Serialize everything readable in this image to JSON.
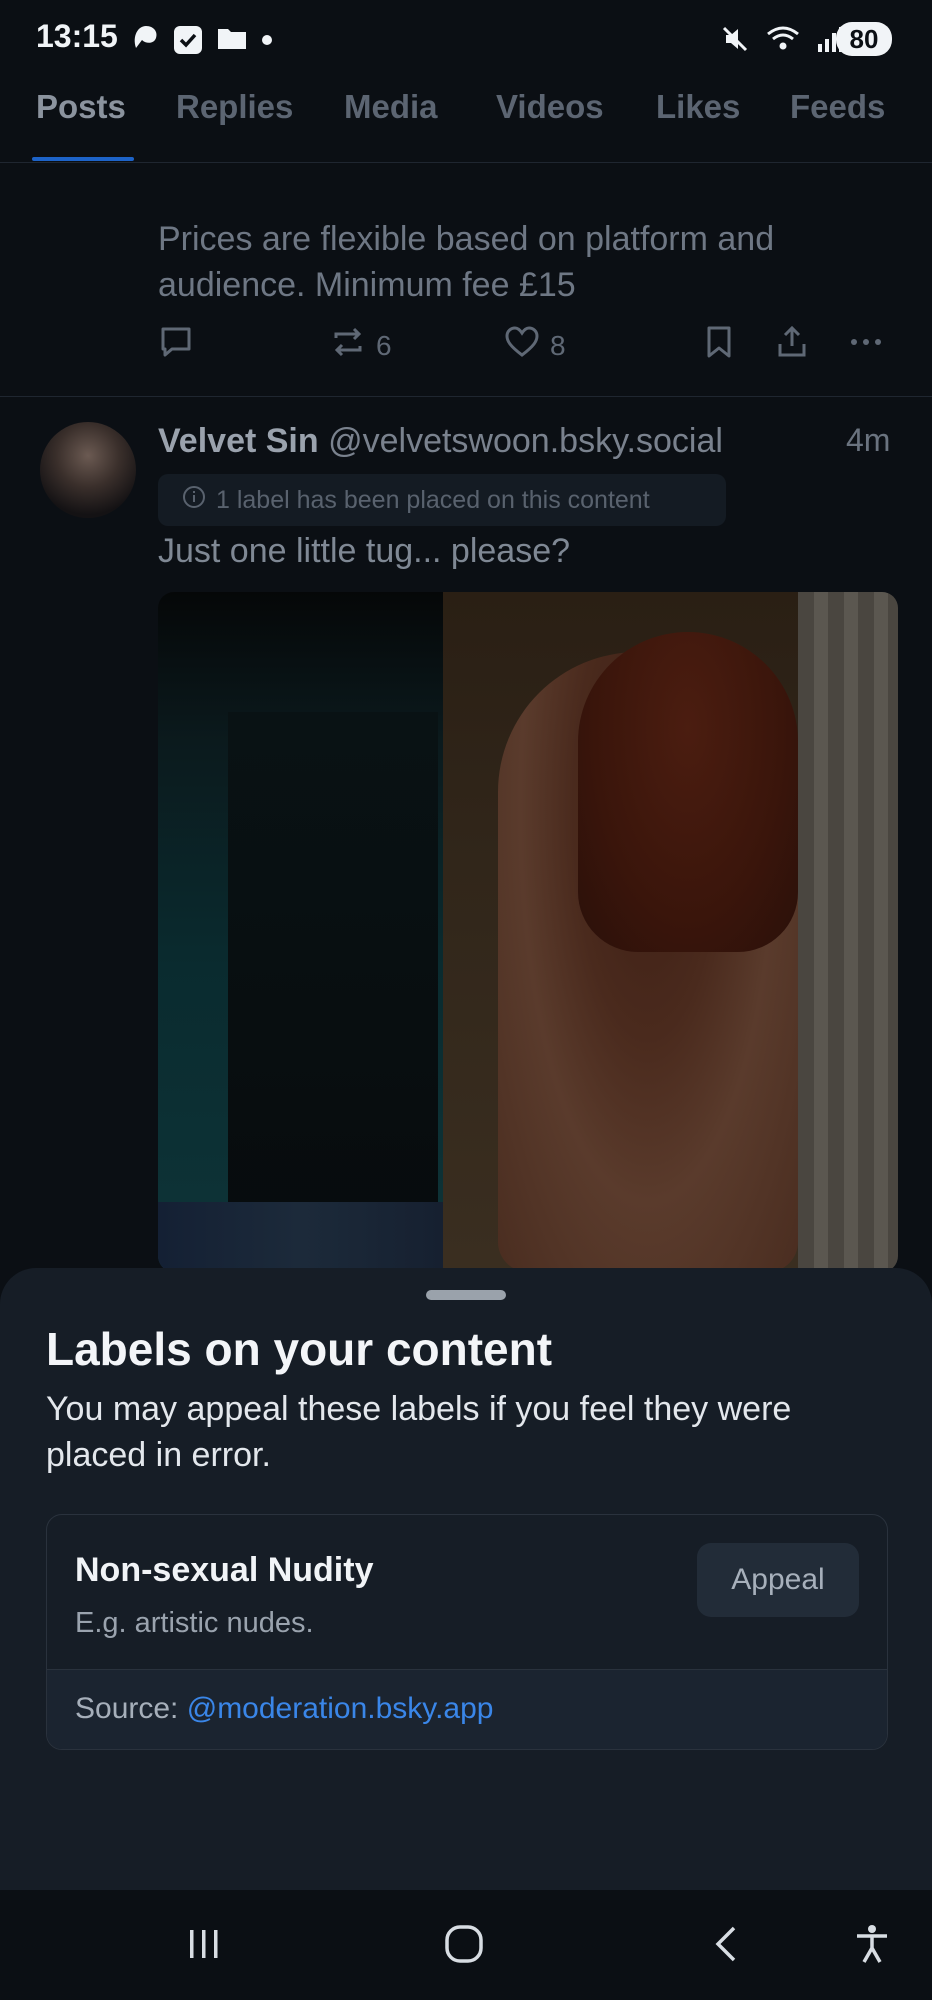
{
  "status_bar": {
    "time": "13:15",
    "battery": "80",
    "left_icons": [
      "app-icon",
      "checkbox-icon",
      "folder-icon",
      "dot-icon"
    ],
    "right_icons": [
      "mute-icon",
      "wifi-icon",
      "signal-icon"
    ]
  },
  "tabs": [
    {
      "label": "Posts",
      "active": true
    },
    {
      "label": "Replies"
    },
    {
      "label": "Media"
    },
    {
      "label": "Videos"
    },
    {
      "label": "Likes"
    },
    {
      "label": "Feeds"
    }
  ],
  "previous_post": {
    "text": "Prices are flexible based on platform and audience. Minimum fee £15",
    "reposts": "6",
    "likes": "8"
  },
  "post": {
    "display_name": "Velvet Sin",
    "handle": "@velvetswoon.bsky.social",
    "time": "4m",
    "label_notice": "1 label has been placed on this content",
    "text": "Just one little tug... please?"
  },
  "sheet": {
    "title": "Labels on your content",
    "description": "You may appeal these labels if you feel they were placed in error.",
    "label_name": "Non-sexual Nudity",
    "label_description": "E.g. artistic nudes.",
    "appeal_label": "Appeal",
    "source_prefix": "Source: ",
    "source_link": "@moderation.bsky.app"
  },
  "colors": {
    "accent": "#1d63c8",
    "link": "#3a86e8",
    "sheet_bg": "#161d26",
    "page_bg": "#0b0f14"
  }
}
